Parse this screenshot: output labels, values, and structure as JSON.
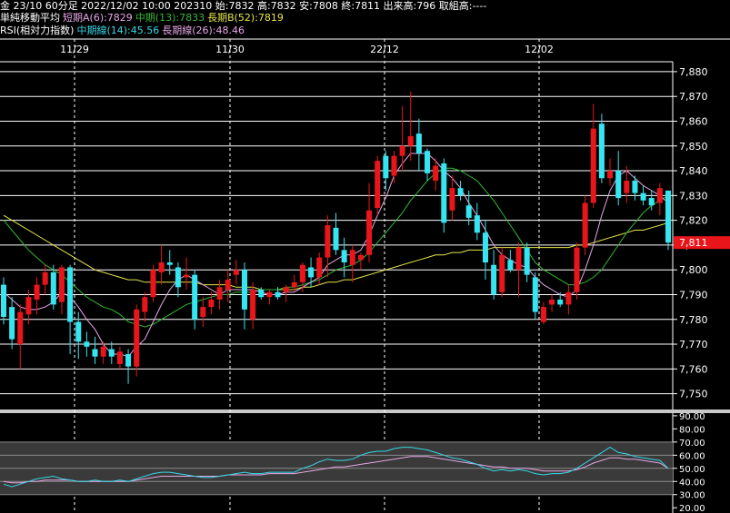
{
  "header": {
    "line1": "金 23/10 60分足 2022/12/02 10:00 202310 始:7832 高:7832 安:7808 終:7811 出来高:796 取組高:----",
    "ma_title": "単純移動平均",
    "ma_short": "短期A(6):7829",
    "ma_mid": "中期(13):7833",
    "ma_long": "長期B(52):7819",
    "rsi_title": "RSI(相対力指数)",
    "rsi_mid": "中期線(14):45.56",
    "rsi_long": "長期線(26):48.46"
  },
  "colors": {
    "background": "#000000",
    "grid": "#ffffff",
    "up": "#e8161b",
    "down": "#35e6f2",
    "ma_short": "#e7a6e8",
    "ma_mid": "#32b832",
    "ma_long": "#e6e64a",
    "rsi_mid": "#35d7e6",
    "rsi_long": "#e6a6e6",
    "price_tag": "#e8161b"
  },
  "chart_data": [
    {
      "type": "candlestick",
      "x_labels": [
        "11/29",
        "11/30",
        "22/12",
        "12/02"
      ],
      "x_label_positions": [
        5,
        28,
        47,
        66
      ],
      "y_ticks": [
        "7,880",
        "7,870",
        "7,860",
        "7,850",
        "7,840",
        "7,830",
        "7,820",
        "7,810",
        "7,800",
        "7,790",
        "7,780",
        "7,770",
        "7,760",
        "7,750"
      ],
      "y_tick_values": [
        7880,
        7870,
        7860,
        7850,
        7840,
        7830,
        7820,
        7810,
        7800,
        7790,
        7780,
        7770,
        7760,
        7750
      ],
      "ylim": [
        7744,
        7884
      ],
      "last_price_label": "7,811",
      "last_price": 7811,
      "candles": [
        {
          "o": 7794,
          "h": 7797,
          "l": 7778,
          "c": 7781
        },
        {
          "o": 7785,
          "h": 7789,
          "l": 7768,
          "c": 7772
        },
        {
          "o": 7770,
          "h": 7786,
          "l": 7760,
          "c": 7783
        },
        {
          "o": 7782,
          "h": 7792,
          "l": 7778,
          "c": 7789
        },
        {
          "o": 7788,
          "h": 7797,
          "l": 7782,
          "c": 7794
        },
        {
          "o": 7794,
          "h": 7802,
          "l": 7790,
          "c": 7799
        },
        {
          "o": 7799,
          "h": 7802,
          "l": 7784,
          "c": 7786
        },
        {
          "o": 7787,
          "h": 7802,
          "l": 7782,
          "c": 7801
        },
        {
          "o": 7801,
          "h": 7802,
          "l": 7766,
          "c": 7779
        },
        {
          "o": 7779,
          "h": 7783,
          "l": 7764,
          "c": 7771
        },
        {
          "o": 7771,
          "h": 7775,
          "l": 7765,
          "c": 7769
        },
        {
          "o": 7768,
          "h": 7773,
          "l": 7762,
          "c": 7765
        },
        {
          "o": 7765,
          "h": 7771,
          "l": 7762,
          "c": 7769
        },
        {
          "o": 7768,
          "h": 7771,
          "l": 7762,
          "c": 7765
        },
        {
          "o": 7762,
          "h": 7769,
          "l": 7760,
          "c": 7767
        },
        {
          "o": 7766,
          "h": 7768,
          "l": 7754,
          "c": 7761
        },
        {
          "o": 7761,
          "h": 7786,
          "l": 7757,
          "c": 7784
        },
        {
          "o": 7783,
          "h": 7791,
          "l": 7779,
          "c": 7789
        },
        {
          "o": 7789,
          "h": 7802,
          "l": 7787,
          "c": 7800
        },
        {
          "o": 7799,
          "h": 7810,
          "l": 7794,
          "c": 7803
        },
        {
          "o": 7803,
          "h": 7808,
          "l": 7798,
          "c": 7802
        },
        {
          "o": 7801,
          "h": 7803,
          "l": 7789,
          "c": 7793
        },
        {
          "o": 7797,
          "h": 7805,
          "l": 7792,
          "c": 7798
        },
        {
          "o": 7798,
          "h": 7800,
          "l": 7776,
          "c": 7780
        },
        {
          "o": 7781,
          "h": 7789,
          "l": 7777,
          "c": 7785
        },
        {
          "o": 7785,
          "h": 7791,
          "l": 7782,
          "c": 7788
        },
        {
          "o": 7788,
          "h": 7796,
          "l": 7784,
          "c": 7793
        },
        {
          "o": 7792,
          "h": 7800,
          "l": 7787,
          "c": 7796
        },
        {
          "o": 7798,
          "h": 7804,
          "l": 7794,
          "c": 7800
        },
        {
          "o": 7800,
          "h": 7803,
          "l": 7776,
          "c": 7784
        },
        {
          "o": 7780,
          "h": 7795,
          "l": 7776,
          "c": 7792
        },
        {
          "o": 7792,
          "h": 7793,
          "l": 7788,
          "c": 7789
        },
        {
          "o": 7789,
          "h": 7792,
          "l": 7786,
          "c": 7791
        },
        {
          "o": 7791,
          "h": 7793,
          "l": 7788,
          "c": 7789
        },
        {
          "o": 7791,
          "h": 7794,
          "l": 7787,
          "c": 7793
        },
        {
          "o": 7793,
          "h": 7798,
          "l": 7791,
          "c": 7795
        },
        {
          "o": 7795,
          "h": 7803,
          "l": 7791,
          "c": 7802
        },
        {
          "o": 7801,
          "h": 7805,
          "l": 7793,
          "c": 7797
        },
        {
          "o": 7797,
          "h": 7807,
          "l": 7794,
          "c": 7805
        },
        {
          "o": 7805,
          "h": 7822,
          "l": 7797,
          "c": 7818
        },
        {
          "o": 7817,
          "h": 7823,
          "l": 7806,
          "c": 7808
        },
        {
          "o": 7808,
          "h": 7813,
          "l": 7797,
          "c": 7803
        },
        {
          "o": 7802,
          "h": 7810,
          "l": 7795,
          "c": 7808
        },
        {
          "o": 7804,
          "h": 7807,
          "l": 7800,
          "c": 7806
        },
        {
          "o": 7806,
          "h": 7835,
          "l": 7803,
          "c": 7824
        },
        {
          "o": 7825,
          "h": 7846,
          "l": 7822,
          "c": 7844
        },
        {
          "o": 7846,
          "h": 7848,
          "l": 7832,
          "c": 7837
        },
        {
          "o": 7838,
          "h": 7848,
          "l": 7835,
          "c": 7846
        },
        {
          "o": 7846,
          "h": 7866,
          "l": 7840,
          "c": 7850
        },
        {
          "o": 7850,
          "h": 7872,
          "l": 7844,
          "c": 7854
        },
        {
          "o": 7855,
          "h": 7861,
          "l": 7840,
          "c": 7847
        },
        {
          "o": 7848,
          "h": 7849,
          "l": 7836,
          "c": 7839
        },
        {
          "o": 7836,
          "h": 7845,
          "l": 7832,
          "c": 7842
        },
        {
          "o": 7843,
          "h": 7845,
          "l": 7815,
          "c": 7819
        },
        {
          "o": 7824,
          "h": 7838,
          "l": 7820,
          "c": 7833
        },
        {
          "o": 7833,
          "h": 7836,
          "l": 7828,
          "c": 7830
        },
        {
          "o": 7826,
          "h": 7832,
          "l": 7818,
          "c": 7821
        },
        {
          "o": 7822,
          "h": 7827,
          "l": 7812,
          "c": 7815
        },
        {
          "o": 7815,
          "h": 7820,
          "l": 7796,
          "c": 7803
        },
        {
          "o": 7802,
          "h": 7808,
          "l": 7788,
          "c": 7790
        },
        {
          "o": 7791,
          "h": 7809,
          "l": 7789,
          "c": 7806
        },
        {
          "o": 7804,
          "h": 7808,
          "l": 7799,
          "c": 7800
        },
        {
          "o": 7800,
          "h": 7811,
          "l": 7789,
          "c": 7809
        },
        {
          "o": 7809,
          "h": 7811,
          "l": 7795,
          "c": 7798
        },
        {
          "o": 7797,
          "h": 7799,
          "l": 7780,
          "c": 7783
        },
        {
          "o": 7779,
          "h": 7787,
          "l": 7778,
          "c": 7785
        },
        {
          "o": 7786,
          "h": 7790,
          "l": 7783,
          "c": 7788
        },
        {
          "o": 7788,
          "h": 7791,
          "l": 7785,
          "c": 7786
        },
        {
          "o": 7786,
          "h": 7794,
          "l": 7782,
          "c": 7791
        },
        {
          "o": 7791,
          "h": 7811,
          "l": 7788,
          "c": 7809
        },
        {
          "o": 7809,
          "h": 7830,
          "l": 7806,
          "c": 7827
        },
        {
          "o": 7827,
          "h": 7867,
          "l": 7825,
          "c": 7857
        },
        {
          "o": 7859,
          "h": 7863,
          "l": 7835,
          "c": 7837
        },
        {
          "o": 7837,
          "h": 7845,
          "l": 7834,
          "c": 7840
        },
        {
          "o": 7840,
          "h": 7848,
          "l": 7826,
          "c": 7829
        },
        {
          "o": 7831,
          "h": 7842,
          "l": 7827,
          "c": 7836
        },
        {
          "o": 7836,
          "h": 7838,
          "l": 7828,
          "c": 7831
        },
        {
          "o": 7831,
          "h": 7834,
          "l": 7826,
          "c": 7828
        },
        {
          "o": 7829,
          "h": 7832,
          "l": 7824,
          "c": 7826
        },
        {
          "o": 7827,
          "h": 7835,
          "l": 7822,
          "c": 7833
        },
        {
          "o": 7832,
          "h": 7832,
          "l": 7808,
          "c": 7811
        }
      ],
      "ma_short": [
        7791,
        7788,
        7785,
        7784,
        7784,
        7785,
        7787,
        7791,
        7789,
        7785,
        7780,
        7776,
        7770,
        7766,
        7766,
        7765,
        7769,
        7772,
        7779,
        7786,
        7792,
        7796,
        7798,
        7796,
        7794,
        7792,
        7790,
        7792,
        7792,
        7792,
        7792,
        7791,
        7790,
        7790,
        7791,
        7791,
        7793,
        7795,
        7797,
        7802,
        7804,
        7806,
        7806,
        7808,
        7814,
        7822,
        7829,
        7838,
        7843,
        7847,
        7847,
        7847,
        7844,
        7840,
        7837,
        7833,
        7827,
        7822,
        7816,
        7810,
        7806,
        7804,
        7802,
        7801,
        7797,
        7794,
        7792,
        7790,
        7789,
        7792,
        7800,
        7810,
        7822,
        7832,
        7838,
        7840,
        7837,
        7834,
        7832,
        7830,
        7827
      ],
      "ma_mid": [
        7820,
        7816,
        7812,
        7808,
        7805,
        7802,
        7800,
        7798,
        7795,
        7792,
        7789,
        7787,
        7785,
        7784,
        7782,
        7779,
        7778,
        7777,
        7778,
        7780,
        7782,
        7784,
        7786,
        7787,
        7788,
        7789,
        7790,
        7790,
        7791,
        7791,
        7791,
        7792,
        7792,
        7792,
        7793,
        7793,
        7794,
        7795,
        7796,
        7798,
        7800,
        7801,
        7802,
        7804,
        7807,
        7811,
        7815,
        7819,
        7823,
        7828,
        7832,
        7836,
        7839,
        7841,
        7841,
        7840,
        7838,
        7836,
        7832,
        7828,
        7823,
        7818,
        7813,
        7808,
        7803,
        7800,
        7798,
        7796,
        7794,
        7794,
        7795,
        7797,
        7800,
        7805,
        7810,
        7815,
        7819,
        7823,
        7826,
        7828,
        7830
      ],
      "ma_long": [
        7822,
        7820,
        7818,
        7816,
        7814,
        7812,
        7810,
        7808,
        7806,
        7804,
        7802,
        7800,
        7799,
        7798,
        7797,
        7796,
        7796,
        7795,
        7795,
        7795,
        7795,
        7795,
        7795,
        7795,
        7794,
        7794,
        7794,
        7794,
        7793,
        7793,
        7793,
        7792,
        7792,
        7792,
        7792,
        7792,
        7793,
        7793,
        7794,
        7795,
        7795,
        7796,
        7796,
        7797,
        7798,
        7799,
        7800,
        7801,
        7802,
        7803,
        7804,
        7805,
        7806,
        7806,
        7807,
        7807,
        7808,
        7808,
        7808,
        7809,
        7809,
        7809,
        7809,
        7809,
        7809,
        7809,
        7809,
        7809,
        7809,
        7810,
        7810,
        7811,
        7812,
        7813,
        7814,
        7815,
        7816,
        7816,
        7817,
        7818,
        7819
      ]
    },
    {
      "type": "line",
      "title": "RSI",
      "y_ticks": [
        "90.00",
        "80.00",
        "70.00",
        "60.00",
        "50.00",
        "40.00",
        "30.00",
        "20.00"
      ],
      "y_tick_values": [
        90,
        80,
        70,
        60,
        50,
        40,
        30,
        20
      ],
      "ylim": [
        16,
        92
      ],
      "series": [
        {
          "name": "中期線(14)",
          "values": [
            38,
            36,
            38,
            40,
            42,
            43,
            44,
            42,
            41,
            40,
            40,
            41,
            40,
            40,
            41,
            40,
            42,
            44,
            46,
            47,
            47,
            46,
            45,
            44,
            43,
            43,
            44,
            45,
            46,
            47,
            46,
            46,
            47,
            47,
            47,
            47,
            50,
            52,
            55,
            57,
            56,
            56,
            57,
            60,
            62,
            63,
            63,
            65,
            66,
            66,
            65,
            64,
            62,
            60,
            58,
            57,
            55,
            53,
            50,
            48,
            49,
            48,
            49,
            48,
            46,
            45,
            46,
            46,
            47,
            50,
            54,
            58,
            62,
            66,
            62,
            61,
            59,
            58,
            57,
            56,
            50
          ]
        },
        {
          "name": "長期線(26)",
          "values": [
            40,
            39,
            39,
            40,
            40,
            41,
            41,
            41,
            41,
            40,
            40,
            40,
            40,
            40,
            40,
            40,
            41,
            42,
            43,
            44,
            44,
            44,
            44,
            44,
            44,
            44,
            44,
            45,
            45,
            45,
            45,
            45,
            46,
            46,
            46,
            46,
            47,
            48,
            49,
            50,
            51,
            51,
            52,
            53,
            54,
            55,
            56,
            57,
            58,
            59,
            59,
            59,
            58,
            57,
            56,
            55,
            54,
            53,
            52,
            51,
            51,
            50,
            50,
            50,
            49,
            48,
            48,
            48,
            48,
            49,
            51,
            54,
            56,
            58,
            58,
            57,
            57,
            56,
            55,
            54,
            50
          ]
        }
      ]
    }
  ]
}
